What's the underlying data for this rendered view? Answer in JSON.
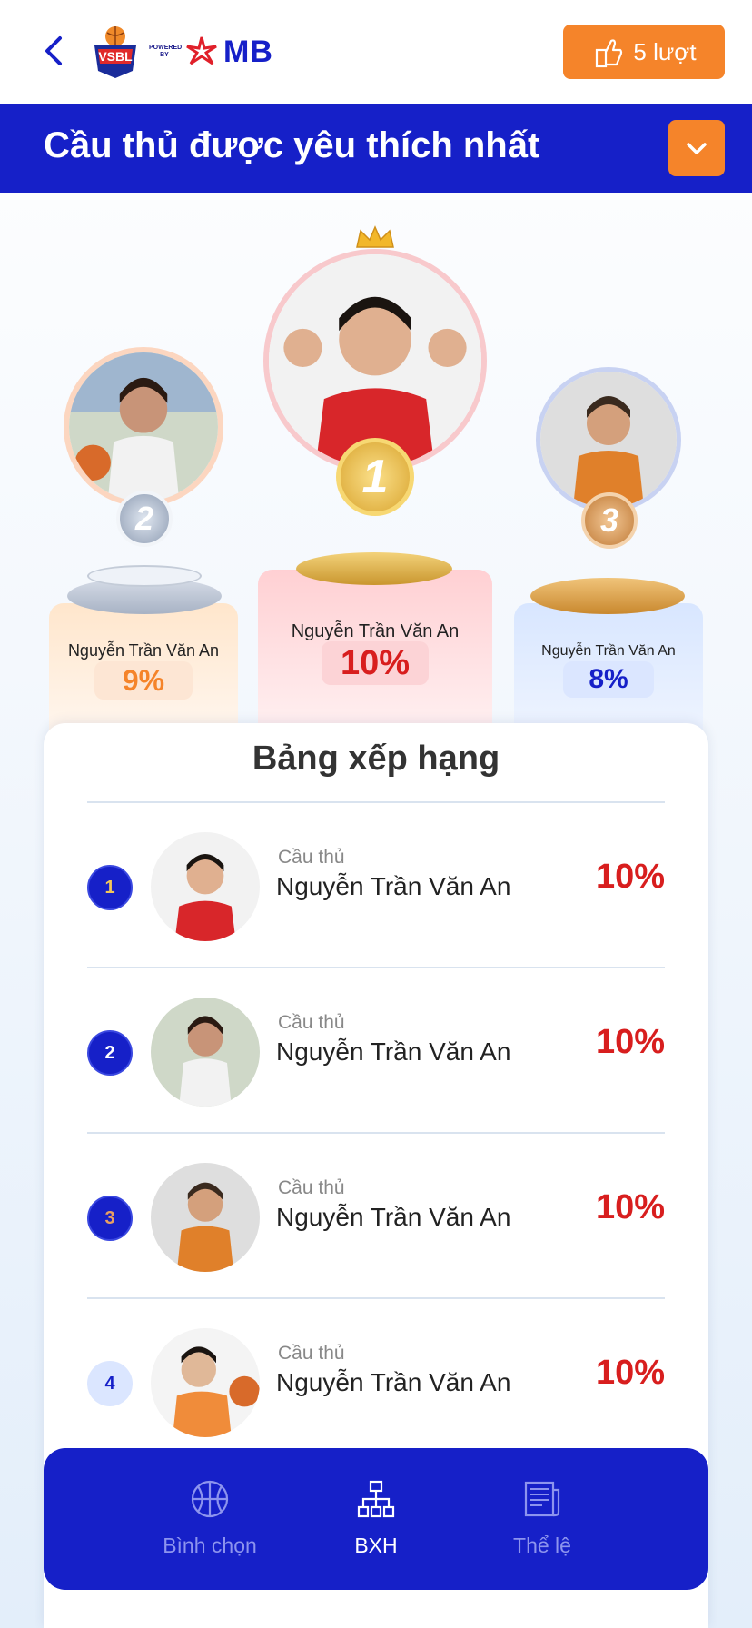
{
  "header": {
    "logo_text": "VSBL",
    "powered_by": "POWERED BY",
    "sponsor": "MB",
    "votes_label": "5 lượt"
  },
  "title_bar": {
    "title": "Cầu thủ được yêu thích nhất"
  },
  "podium": [
    {
      "rank": "2",
      "name": "Nguyễn Trần Văn An",
      "percent": "9%",
      "accent": "#f5842a"
    },
    {
      "rank": "1",
      "name": "Nguyễn Trần Văn An",
      "percent": "10%",
      "accent": "#d81e1e"
    },
    {
      "rank": "3",
      "name": "Nguyễn Trần Văn An",
      "percent": "8%",
      "accent": "#1620c8"
    }
  ],
  "ranking": {
    "title": "Bảng xếp hạng",
    "rows": [
      {
        "rank": "1",
        "role": "Cầu thủ",
        "name": "Nguyễn Trần Văn An",
        "percent": "10%"
      },
      {
        "rank": "2",
        "role": "Cầu thủ",
        "name": "Nguyễn Trần Văn An",
        "percent": "10%"
      },
      {
        "rank": "3",
        "role": "Cầu thủ",
        "name": "Nguyễn Trần Văn An",
        "percent": "10%"
      },
      {
        "rank": "4",
        "role": "Cầu thủ",
        "name": "Nguyễn Trần Văn An",
        "percent": "10%"
      }
    ]
  },
  "nav": {
    "items": [
      {
        "label": "Bình chọn",
        "icon": "basketball-icon"
      },
      {
        "label": "BXH",
        "icon": "hierarchy-icon"
      },
      {
        "label": "Thể lệ",
        "icon": "document-icon"
      }
    ]
  },
  "colors": {
    "primary": "#1620c8",
    "accent": "#f5842a",
    "percent_red": "#d81e1e"
  }
}
